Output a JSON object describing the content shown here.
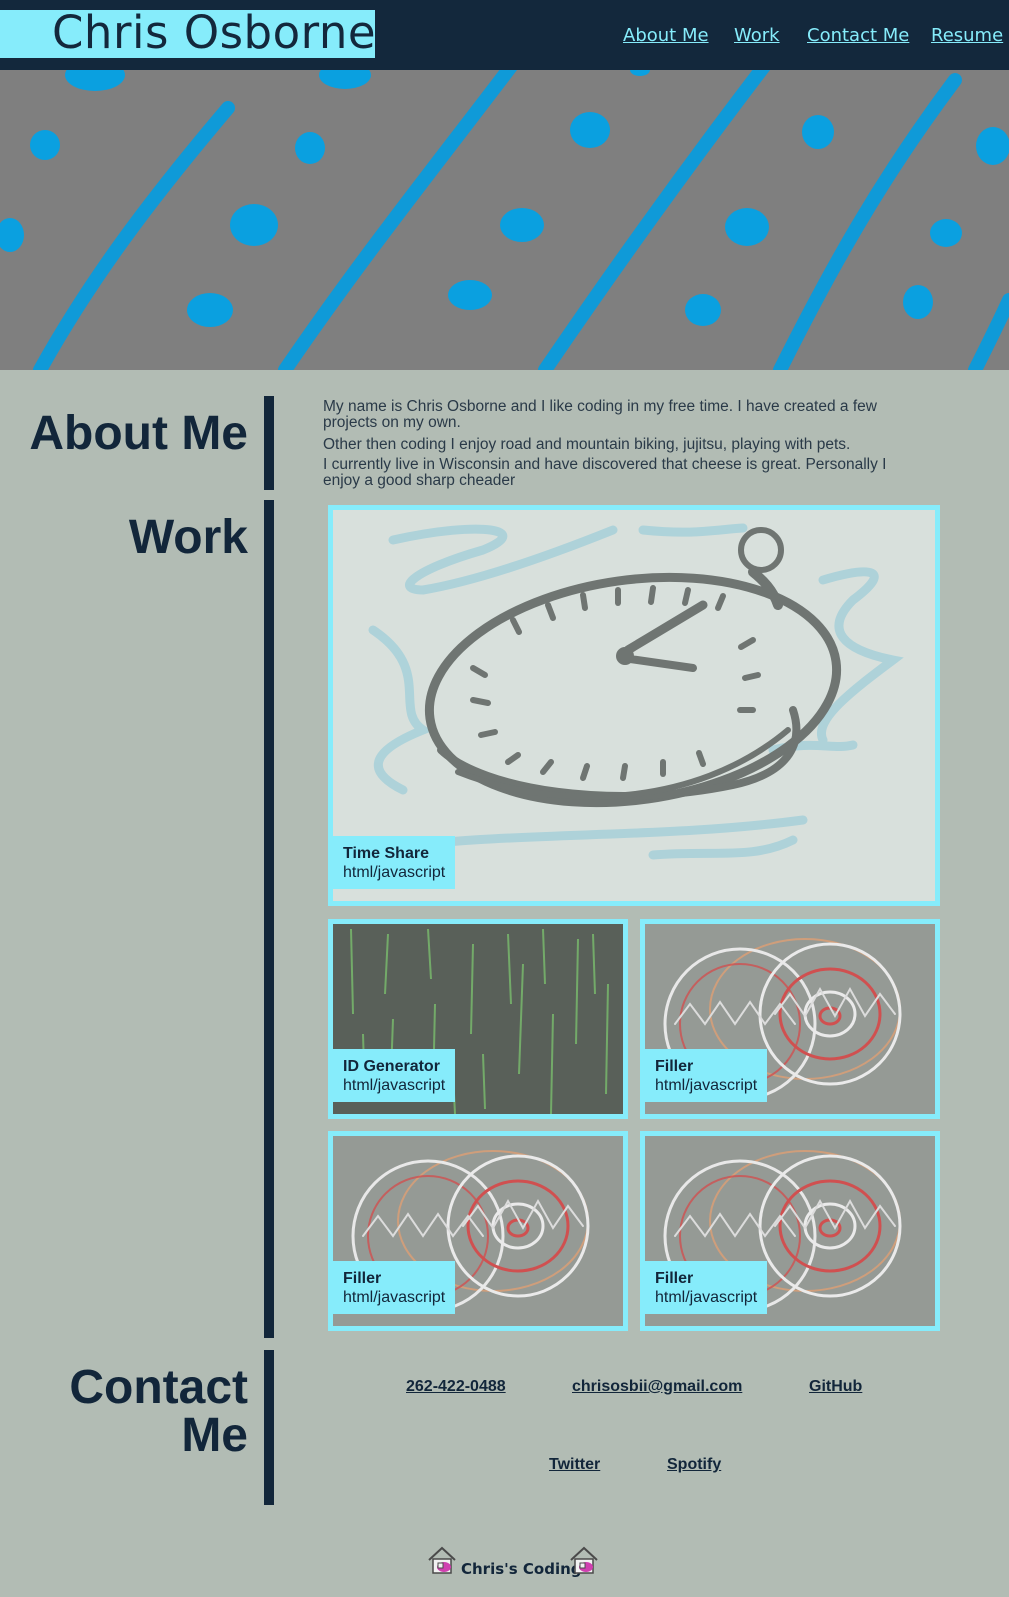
{
  "header": {
    "brand": "Chris Osborne",
    "nav": [
      "About Me",
      "Work",
      "Contact Me",
      "Resume"
    ]
  },
  "about": {
    "title": "About Me",
    "paragraphs": [
      "My name is Chris Osborne and I like coding in my free time. I have created a few projects on my own.",
      "Other then coding I enjoy road and mountain biking, jujitsu, playing with pets.",
      "I currently live in Wisconsin and have discovered that cheese is great. Personally I enjoy a good sharp cheader"
    ]
  },
  "work": {
    "title": "Work",
    "projects": [
      {
        "name": "Time Share",
        "tech": "html/javascript",
        "image": "pocket-watch-sketch"
      },
      {
        "name": "ID Generator",
        "tech": "html/javascript",
        "image": "green-rain-sketch"
      },
      {
        "name": "Filler",
        "tech": "html/javascript",
        "image": "tire-sketch"
      },
      {
        "name": "Filler",
        "tech": "html/javascript",
        "image": "tire-sketch"
      },
      {
        "name": "Filler",
        "tech": "html/javascript",
        "image": "tire-sketch"
      }
    ]
  },
  "contact": {
    "title_line1": "Contact",
    "title_line2": "Me",
    "links": [
      "262-422-0488",
      "chrisosbii@gmail.com",
      "GitHub",
      "Twitter",
      "Spotify"
    ]
  },
  "footer": {
    "text": "Chris's Coding",
    "icon": "house-icon"
  },
  "colors": {
    "navy": "#13283c",
    "accent": "#86ecfb",
    "page": "#b2bcb4",
    "hero": "#7f7f7f",
    "hero_marks": "#0aa0e0"
  }
}
